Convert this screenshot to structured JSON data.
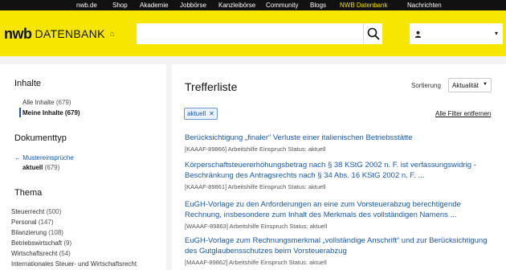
{
  "topnav": {
    "items": [
      {
        "label": "nwb.de"
      },
      {
        "label": "Shop"
      },
      {
        "label": "Akademie"
      },
      {
        "label": "Jobbörse"
      },
      {
        "label": "Kanzleibörse"
      },
      {
        "label": "Community"
      },
      {
        "label": "Blogs"
      },
      {
        "label": "NWB Datenbank",
        "active": true
      },
      {
        "label": "Nachrichten"
      }
    ]
  },
  "header": {
    "logo_nwb": "nwb",
    "logo_db": "DATENBANK",
    "search": {
      "value": "",
      "placeholder": ""
    },
    "icons": {
      "search": "search-icon",
      "home": "home-icon",
      "user": "user-icon"
    },
    "colors": {
      "brand_yellow": "#f6e600",
      "link_blue": "#1a5aa6"
    }
  },
  "sidebar": {
    "inhalte": {
      "heading": "Inhalte",
      "items": [
        {
          "label": "Alle Inhalte",
          "count": "(679)"
        },
        {
          "label": "Meine Inhalte",
          "count": "(679)",
          "selected": true
        }
      ]
    },
    "dokumenttyp": {
      "heading": "Dokumenttyp",
      "back": "← Mustereinsprüche",
      "current": {
        "label": "aktuell",
        "count": "(679)"
      }
    },
    "thema": {
      "heading": "Thema",
      "items": [
        {
          "label": "Steuerrecht",
          "count": "(500)"
        },
        {
          "label": "Personal",
          "count": "(147)"
        },
        {
          "label": "Bilanzierung",
          "count": "(108)"
        },
        {
          "label": "Betriebswirtschaft",
          "count": "(9)"
        },
        {
          "label": "Wirtschaftsrecht",
          "count": "(54)"
        },
        {
          "label": "Internationales Steuer- und Wirtschaftsrecht",
          "count": ""
        }
      ]
    }
  },
  "main": {
    "title": "Trefferliste",
    "sort_label": "Sortierung",
    "sort_value": "Aktualität",
    "filter_chip": "aktuell",
    "clear_filters": "Alle Filter entfernen",
    "results": [
      {
        "title": "Berücksichtigung „finaler“ Verluste einer italienischen Betriebsstätte",
        "meta": "[KAAAF-89866] Arbeitshilfe Einspruch Status: aktuell"
      },
      {
        "title": "Körperschaftsteuererhöhungsbetrag nach § 38 KStG 2002 n. F. ist verfassungswidrig - Beschränkung des Antragsrechts nach § 34 Abs. 16 KStG 2002 n. F. ...",
        "meta": "[KAAAF-89861] Arbeitshilfe Einspruch Status: aktuell"
      },
      {
        "title": "EuGH-Vorlage zu den Anforderungen an eine zum Vorsteuerabzug berechtigende Rechnung, insbesondere zum Inhalt des Merkmals des vollständigen Namens ...",
        "meta": "[WAAAF-89863] Arbeitshilfe Einspruch Status: aktuell"
      },
      {
        "title": "EuGH-Vorlage zum Rechnungsmerkmal „vollständige Anschrift“ und zur Berücksichtigung des Gutglaubensschutzes beim Vorsteuerabzug",
        "meta": "[MAAAF-89862] Arbeitshilfe Einspruch Status: aktuell"
      }
    ]
  }
}
